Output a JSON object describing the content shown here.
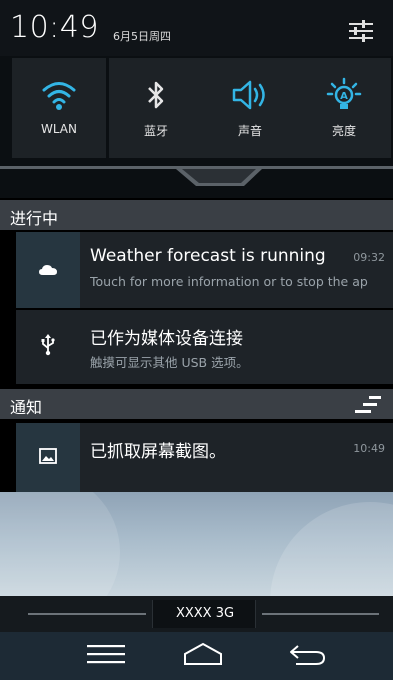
{
  "status": {
    "time": "10:49",
    "date": "6月5日周四"
  },
  "quick_settings": [
    {
      "label": "WLAN",
      "icon": "wifi-icon"
    },
    {
      "label": "蓝牙",
      "icon": "bluetooth-icon"
    },
    {
      "label": "声音",
      "icon": "volume-icon"
    },
    {
      "label": "亮度",
      "icon": "brightness-icon"
    }
  ],
  "sections": {
    "ongoing_title": "进行中",
    "notifications_title": "通知"
  },
  "notifications": [
    {
      "icon": "cloud-icon",
      "title": "Weather forecast is running",
      "subtitle": "Touch for more information or to stop the ap",
      "time": "09:32"
    },
    {
      "icon": "usb-icon",
      "title": "已作为媒体设备连接",
      "subtitle": "触摸可显示其他 USB 选项。",
      "time": ""
    },
    {
      "icon": "image-icon",
      "title": "已抓取屏幕截图。",
      "subtitle": "",
      "time": "10:49"
    }
  ],
  "carrier": "XXXX 3G",
  "colors": {
    "accent": "#33b5e5",
    "panel": "#1e2328",
    "section_header": "#3a3f45"
  }
}
